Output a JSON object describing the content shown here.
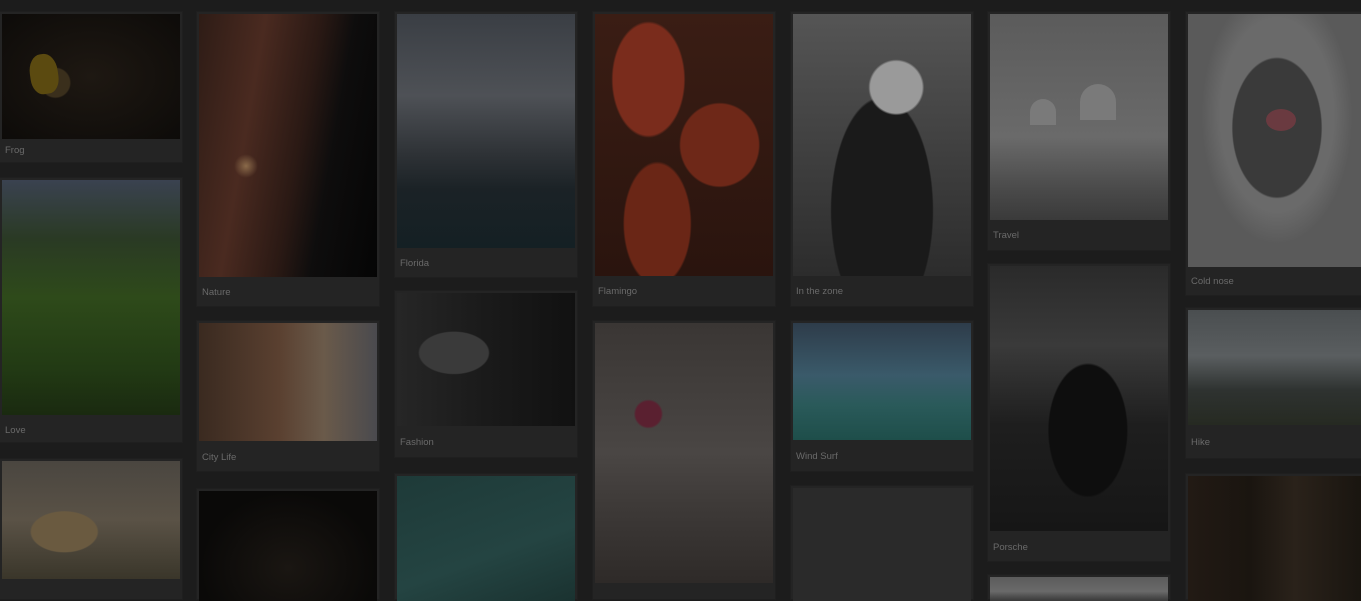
{
  "gallery": {
    "captions": {
      "frog": "Frog",
      "nature": "Nature",
      "florida": "Florida",
      "flamingo": "Flamingo",
      "in_the_zone": "In the zone",
      "travel": "Travel",
      "cold_nose": "Cold nose",
      "love": "Love",
      "city_life": "City Life",
      "fashion": "Fashion",
      "wind_surf": "Wind Surf",
      "porsche": "Porsche",
      "hike": "Hike"
    }
  },
  "colors": {
    "background": "#1c1c1c",
    "card": "#242424",
    "caption_text": "#6a6a6a"
  }
}
